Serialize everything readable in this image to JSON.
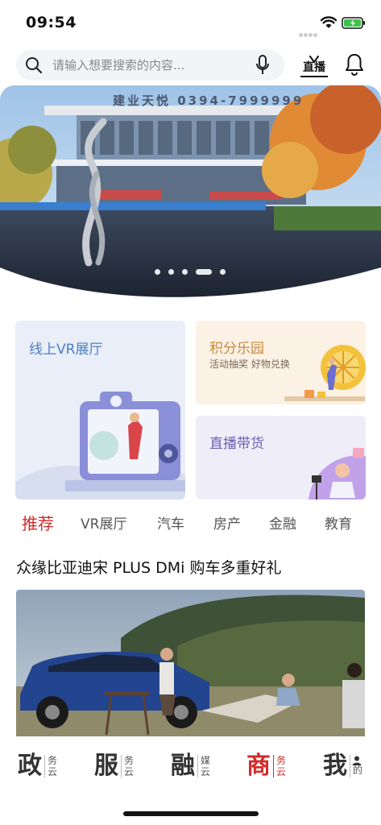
{
  "status": {
    "time": "09:54"
  },
  "search": {
    "placeholder": "请输入想要搜索的内容..."
  },
  "header": {
    "live_label": "直播"
  },
  "banner": {
    "sign_text": "建业天悦  0394-7999999",
    "slide_count": 5,
    "active_slide": 4
  },
  "cards": {
    "vr": {
      "title": "线上VR展厅"
    },
    "points": {
      "title": "积分乐园",
      "subtitle": "活动抽奖 好物兑换"
    },
    "live": {
      "title": "直播带货"
    }
  },
  "tabs": [
    {
      "label": "推荐",
      "active": true
    },
    {
      "label": "VR展厅"
    },
    {
      "label": "汽车"
    },
    {
      "label": "房产"
    },
    {
      "label": "金融"
    },
    {
      "label": "教育"
    }
  ],
  "article": {
    "title": "众缘比亚迪宋 PLUS DMi 购车多重好礼"
  },
  "bottom_nav": [
    {
      "big": "政",
      "small": "务云"
    },
    {
      "big": "服",
      "small": "务云"
    },
    {
      "big": "融",
      "small": "媒云"
    },
    {
      "big": "商",
      "small": "务云",
      "active": true
    },
    {
      "big": "我",
      "small": "的"
    }
  ],
  "colors": {
    "accent_red": "#d22b2b",
    "vr_blue": "#4a7fc4",
    "points_orange": "#c98a3c",
    "live_purple": "#6b61b3"
  }
}
